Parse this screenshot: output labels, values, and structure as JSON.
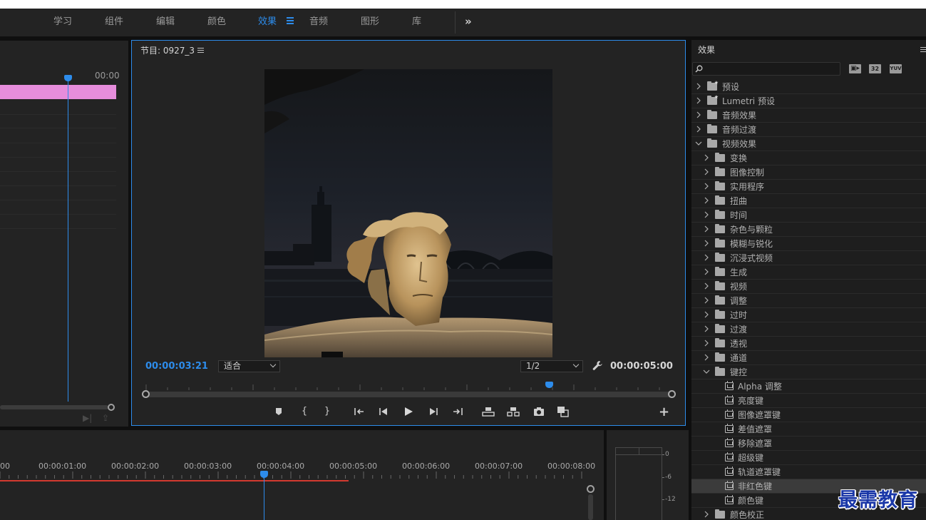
{
  "workspaces": {
    "tabs": [
      "学习",
      "组件",
      "编辑",
      "颜色",
      "效果",
      "音频",
      "图形",
      "库"
    ],
    "active": "效果",
    "more_label": "»"
  },
  "source_panel": {
    "time_label": "00:00"
  },
  "program": {
    "title": "节目: 0927_3",
    "current_time": "00:00:03:21",
    "duration": "00:00:05:00",
    "fit_value": "适合",
    "resolution_value": "1/2",
    "transport_icons": [
      "marker-icon",
      "in-point-icon",
      "out-point-icon",
      "go-to-in-icon",
      "step-back-icon",
      "play-icon",
      "step-forward-icon",
      "go-to-out-icon",
      "lift-icon",
      "extract-icon",
      "export-frame-icon",
      "comparison-view-icon"
    ]
  },
  "effects": {
    "title": "效果",
    "search_placeholder": "",
    "badges": [
      "32",
      "YUV"
    ],
    "tree": [
      {
        "label": "预设",
        "level": 0,
        "kind": "preset-folder",
        "expanded": false
      },
      {
        "label": "Lumetri 预设",
        "level": 0,
        "kind": "preset-folder",
        "expanded": false
      },
      {
        "label": "音频效果",
        "level": 0,
        "kind": "folder",
        "expanded": false
      },
      {
        "label": "音频过渡",
        "level": 0,
        "kind": "folder",
        "expanded": false
      },
      {
        "label": "视频效果",
        "level": 0,
        "kind": "folder",
        "expanded": true
      },
      {
        "label": "变换",
        "level": 1,
        "kind": "folder",
        "expanded": false
      },
      {
        "label": "图像控制",
        "level": 1,
        "kind": "folder",
        "expanded": false
      },
      {
        "label": "实用程序",
        "level": 1,
        "kind": "folder",
        "expanded": false
      },
      {
        "label": "扭曲",
        "level": 1,
        "kind": "folder",
        "expanded": false
      },
      {
        "label": "时间",
        "level": 1,
        "kind": "folder",
        "expanded": false
      },
      {
        "label": "杂色与颗粒",
        "level": 1,
        "kind": "folder",
        "expanded": false
      },
      {
        "label": "模糊与锐化",
        "level": 1,
        "kind": "folder",
        "expanded": false
      },
      {
        "label": "沉浸式视频",
        "level": 1,
        "kind": "folder",
        "expanded": false
      },
      {
        "label": "生成",
        "level": 1,
        "kind": "folder",
        "expanded": false
      },
      {
        "label": "视频",
        "level": 1,
        "kind": "folder",
        "expanded": false
      },
      {
        "label": "调整",
        "level": 1,
        "kind": "folder",
        "expanded": false
      },
      {
        "label": "过时",
        "level": 1,
        "kind": "folder",
        "expanded": false
      },
      {
        "label": "过渡",
        "level": 1,
        "kind": "folder",
        "expanded": false
      },
      {
        "label": "透视",
        "level": 1,
        "kind": "folder",
        "expanded": false
      },
      {
        "label": "通道",
        "level": 1,
        "kind": "folder",
        "expanded": false
      },
      {
        "label": "键控",
        "level": 1,
        "kind": "folder",
        "expanded": true
      },
      {
        "label": "Alpha 调整",
        "level": 2,
        "kind": "effect"
      },
      {
        "label": "亮度键",
        "level": 2,
        "kind": "effect"
      },
      {
        "label": "图像遮罩键",
        "level": 2,
        "kind": "effect"
      },
      {
        "label": "差值遮罩",
        "level": 2,
        "kind": "effect"
      },
      {
        "label": "移除遮罩",
        "level": 2,
        "kind": "effect"
      },
      {
        "label": "超级键",
        "level": 2,
        "kind": "effect"
      },
      {
        "label": "轨道遮罩键",
        "level": 2,
        "kind": "effect"
      },
      {
        "label": "非红色键",
        "level": 2,
        "kind": "effect",
        "selected": true
      },
      {
        "label": "颜色键",
        "level": 2,
        "kind": "effect"
      },
      {
        "label": "颜色校正",
        "level": 1,
        "kind": "folder",
        "expanded": false
      }
    ]
  },
  "timeline": {
    "labels": [
      "00",
      "00:00:01:00",
      "00:00:02:00",
      "00:00:03:00",
      "00:00:04:00",
      "00:00:05:00",
      "00:00:06:00",
      "00:00:07:00",
      "00:00:08:00"
    ]
  },
  "meter": {
    "scale": [
      "0",
      "-6",
      "-12"
    ]
  },
  "watermark": "最需教育",
  "colors": {
    "accent": "#2d8ceb",
    "clip": "#e68ddc",
    "work_area": "#d3392f",
    "watermark": "#1a37a8"
  }
}
